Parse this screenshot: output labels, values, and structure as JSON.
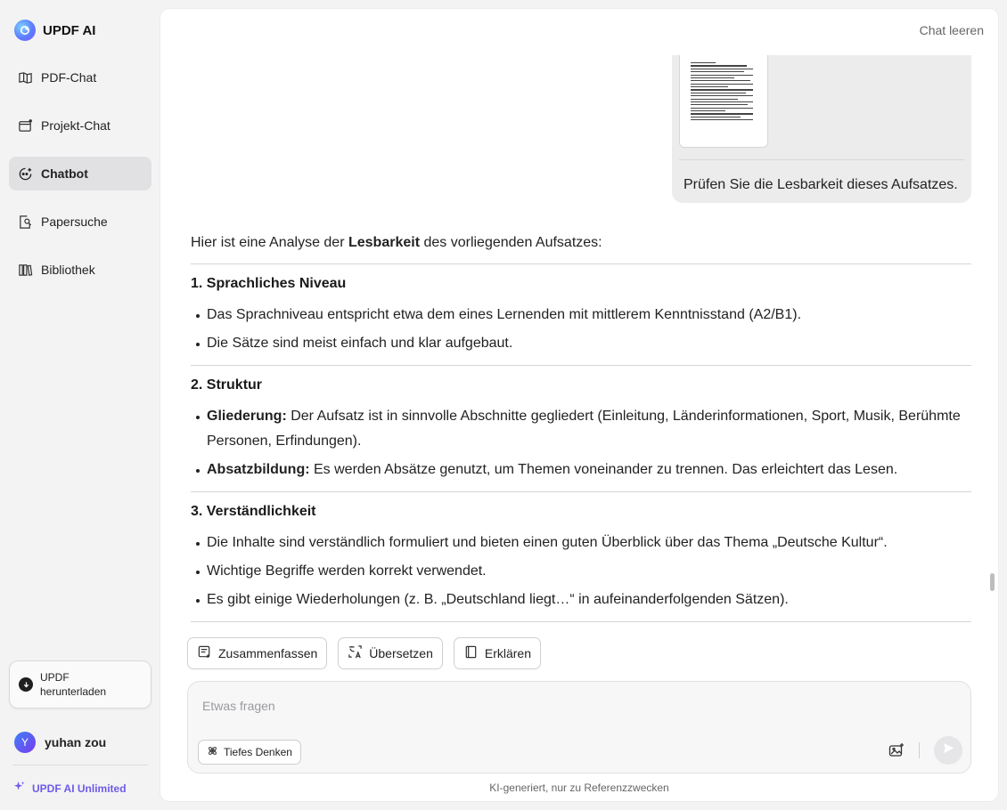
{
  "app": {
    "brand": "UPDF AI",
    "accent_color": "#6d5ae6"
  },
  "sidebar": {
    "items": [
      {
        "label": "PDF-Chat",
        "icon": "book-open-icon"
      },
      {
        "label": "Projekt-Chat",
        "icon": "folder-chat-icon"
      },
      {
        "label": "Chatbot",
        "icon": "bot-chat-icon",
        "active": true
      },
      {
        "label": "Papersuche",
        "icon": "paper-search-icon"
      },
      {
        "label": "Bibliothek",
        "icon": "library-icon"
      }
    ],
    "download_label": "UPDF\nherunterladen",
    "user_initial": "Y",
    "user_name": "yuhan zou",
    "upgrade_label": "UPDF AI Unlimited"
  },
  "header": {
    "clear_chat": "Chat leeren"
  },
  "chat": {
    "user_message": "Prüfen Sie die Lesbarkeit dieses Aufsatzes.",
    "intro": {
      "before": "Hier ist eine Analyse der ",
      "bold": "Lesbarkeit",
      "after": " des vorliegenden Aufsatzes:"
    },
    "sections": [
      {
        "title": "1. Sprachliches Niveau",
        "bullets": [
          {
            "bold": "",
            "text": "Das Sprachniveau entspricht etwa dem eines Lernenden mit mittlerem Kenntnisstand (A2/B1)."
          },
          {
            "bold": "",
            "text": "Die Sätze sind meist einfach und klar aufgebaut."
          }
        ]
      },
      {
        "title": "2. Struktur",
        "bullets": [
          {
            "bold": "Gliederung:",
            "text": " Der Aufsatz ist in sinnvolle Abschnitte gegliedert (Einleitung, Länderinformationen, Sport, Musik, Berühmte Personen, Erfindungen)."
          },
          {
            "bold": "Absatzbildung:",
            "text": " Es werden Absätze genutzt, um Themen voneinander zu trennen. Das erleichtert das Lesen."
          }
        ]
      },
      {
        "title": "3. Verständlichkeit",
        "bullets": [
          {
            "bold": "",
            "text": "Die Inhalte sind verständlich formuliert und bieten einen guten Überblick über das Thema „Deutsche Kultur“."
          },
          {
            "bold": "",
            "text": "Wichtige Begriffe werden korrekt verwendet."
          },
          {
            "bold": "",
            "text": "Es gibt einige Wiederholungen (z. B. „Deutschland liegt…“ in aufeinanderfolgenden Sätzen)."
          }
        ]
      }
    ]
  },
  "quick_actions": {
    "summarize": "Zusammenfassen",
    "translate": "Übersetzen",
    "explain": "Erklären"
  },
  "composer": {
    "placeholder": "Etwas fragen",
    "value": "",
    "deep_think": "Tiefes Denken"
  },
  "footer": {
    "disclaimer": "KI-generiert, nur zu Referenzzwecken"
  }
}
